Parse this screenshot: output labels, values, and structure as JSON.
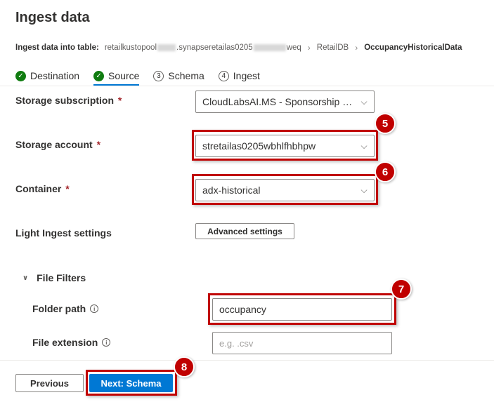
{
  "page": {
    "title": "Ingest data"
  },
  "breadcrumb": {
    "lead": "Ingest data into table:",
    "cluster_part1": "retailkustopool",
    "cluster_part2": ".synapseretailas0205",
    "cluster_part3": "weq",
    "database": "RetailDB",
    "table": "OccupancyHistoricalData"
  },
  "steps": [
    {
      "label": "Destination",
      "status": "done"
    },
    {
      "label": "Source",
      "status": "done",
      "active": true
    },
    {
      "label": "Schema",
      "number": "3"
    },
    {
      "label": "Ingest",
      "number": "4"
    }
  ],
  "form": {
    "storage_subscription": {
      "label": "Storage subscription",
      "required_mark": "*",
      "value": "CloudLabsAI.MS - Sponsorship 0..."
    },
    "storage_account": {
      "label": "Storage account",
      "required_mark": "*",
      "value": "stretailas0205wbhlfhbhpw"
    },
    "container": {
      "label": "Container",
      "required_mark": "*",
      "value": "adx-historical"
    },
    "light_ingest": {
      "label": "Light Ingest settings",
      "button": "Advanced settings"
    },
    "file_filters": {
      "label": "File Filters",
      "folder_path": {
        "label": "Folder path",
        "value": "occupancy"
      },
      "file_extension": {
        "label": "File extension",
        "placeholder": "e.g. .csv"
      }
    }
  },
  "footer": {
    "previous": "Previous",
    "next": "Next: Schema"
  },
  "annotations": [
    "5",
    "6",
    "7",
    "8"
  ],
  "colors": {
    "accent": "#0078d4",
    "success": "#107c10",
    "highlight": "#c00000"
  }
}
